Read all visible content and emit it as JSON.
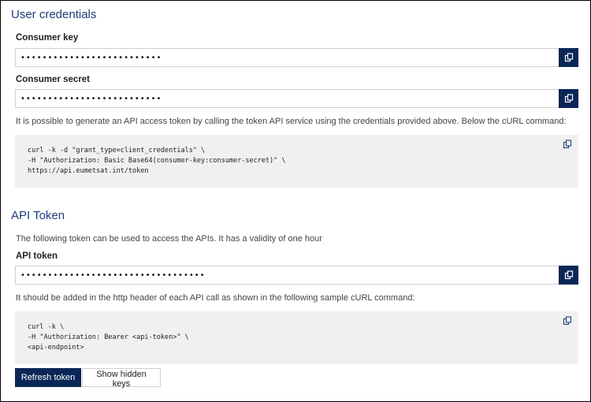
{
  "credentials": {
    "title": "User credentials",
    "consumer_key": {
      "label": "Consumer key",
      "value": "••••••••••••••••••••••••••"
    },
    "consumer_secret": {
      "label": "Consumer secret",
      "value": "••••••••••••••••••••••••••"
    },
    "info": "It is possible to generate an API access token by calling the token API service using the credentials provided above. Below the cURL command:",
    "curl_command": "curl -k -d \"grant_type=client_credentials\" \\\n-H \"Authorization: Basic Base64(consumer-key:consumer-secret)\" \\\nhttps://api.eumetsat.int/token"
  },
  "api_token": {
    "title": "API Token",
    "info": "The following token can be used to access the APIs. It has a validity of one hour",
    "field": {
      "label": "API token",
      "value": "••••••••••••••••••••••••••••••••••"
    },
    "header_info": "It should be added in the http header of each API call as shown in the following sample cURL command:",
    "curl_command": "curl -k \\\n-H \"Authorization: Bearer <api-token>\" \\\n<api-endpoint>"
  },
  "actions": {
    "refresh_label": "Refresh token",
    "show_hidden_label": "Show hidden keys"
  },
  "icons": {
    "copy": "copy-icon"
  },
  "colors": {
    "primary": "#0a2657",
    "heading": "#1f3d7a",
    "code_bg": "#f0f0f0"
  }
}
